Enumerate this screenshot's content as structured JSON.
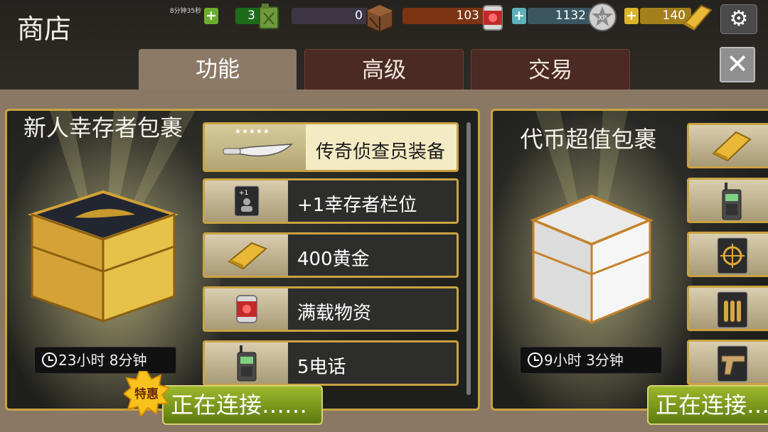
{
  "header": {
    "title": "商店",
    "fuel_timer": "8分钟35秒",
    "fuel_value": "3",
    "supplies_value": "0",
    "cans_value": "103",
    "xp_value": "1132",
    "gold_value": "140"
  },
  "tabs": [
    {
      "label": "功能",
      "active": true
    },
    {
      "label": "高级",
      "active": false
    },
    {
      "label": "交易",
      "active": false
    }
  ],
  "left_panel": {
    "title": "新人幸存者包裹",
    "timer": "23小时 8分钟",
    "items": [
      {
        "label": "传奇侦查员装备",
        "icon": "knife-icon",
        "stars": "★★★★★"
      },
      {
        "label": "+1幸存者栏位",
        "icon": "survivor-slot-card-icon"
      },
      {
        "label": "400黄金",
        "icon": "gold-bar-icon"
      },
      {
        "label": "满载物资",
        "icon": "food-can-icon"
      },
      {
        "label": "5电话",
        "icon": "walkie-talkie-icon"
      }
    ],
    "button_label": "正在连接……",
    "promo_badge": "特惠"
  },
  "right_panel": {
    "title": "代币超值包裹",
    "timer": "9小时 3分钟",
    "items": [
      {
        "icon": "gold-bar-icon"
      },
      {
        "icon": "walkie-talkie-icon"
      },
      {
        "icon": "crosshair-card-icon"
      },
      {
        "icon": "bullets-card-icon"
      },
      {
        "icon": "pistol-card-icon"
      }
    ],
    "button_label": "正在连接……"
  },
  "colors": {
    "gold_border": "#c9a341",
    "buy_button": "#7d9a1d",
    "active_tab": "#8d7a66",
    "inactive_tab": "#4a2a22"
  }
}
